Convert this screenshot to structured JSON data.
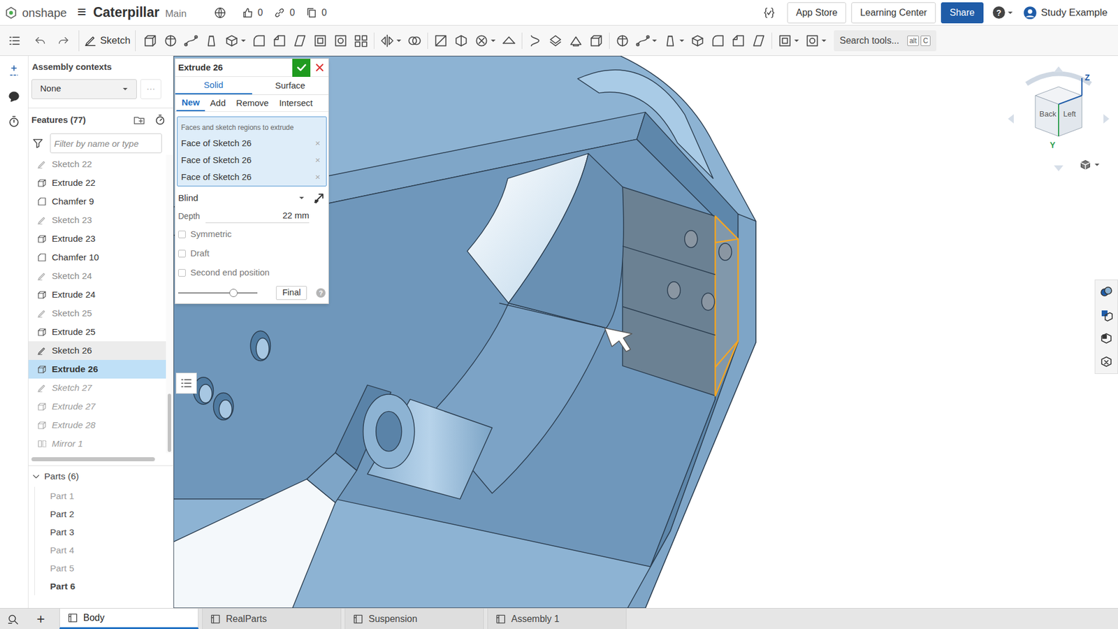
{
  "topbar": {
    "logo": "onshape",
    "menu": "≡",
    "document": "Caterpillar",
    "workspace": "Main",
    "counts": [
      "0",
      "0",
      "0"
    ],
    "buttons": [
      {
        "label": "App Store",
        "primary": false
      },
      {
        "label": "Learning Center",
        "primary": false
      },
      {
        "label": "Share",
        "primary": true
      }
    ],
    "help": "?",
    "user": "Study Example"
  },
  "toolbar": {
    "sketch": "Sketch",
    "search_placeholder": "Search tools...",
    "shortcut_keys": [
      "alt",
      "C"
    ]
  },
  "panel": {
    "assembly_label": "Assembly contexts",
    "assembly_value": "None",
    "assembly_more": "···"
  },
  "features": {
    "title": "Features (77)",
    "filter_placeholder": "Filter by name or type",
    "items": [
      {
        "name": "Sketch 22",
        "kind": "sketch",
        "state": "dimmed",
        "selected": false,
        "hovered": false
      },
      {
        "name": "Extrude 22",
        "kind": "extrude",
        "state": "normal",
        "selected": false,
        "hovered": false
      },
      {
        "name": "Chamfer 9",
        "kind": "chamfer",
        "state": "normal",
        "selected": false,
        "hovered": false
      },
      {
        "name": "Sketch 23",
        "kind": "sketch",
        "state": "dimmed",
        "selected": false,
        "hovered": false
      },
      {
        "name": "Extrude 23",
        "kind": "extrude",
        "state": "normal",
        "selected": false,
        "hovered": false
      },
      {
        "name": "Chamfer 10",
        "kind": "chamfer",
        "state": "normal",
        "selected": false,
        "hovered": false
      },
      {
        "name": "Sketch 24",
        "kind": "sketch",
        "state": "dimmed",
        "selected": false,
        "hovered": false
      },
      {
        "name": "Extrude 24",
        "kind": "extrude",
        "state": "normal",
        "selected": false,
        "hovered": false
      },
      {
        "name": "Sketch 25",
        "kind": "sketch",
        "state": "dimmed",
        "selected": false,
        "hovered": false
      },
      {
        "name": "Extrude 25",
        "kind": "extrude",
        "state": "normal",
        "selected": false,
        "hovered": false
      },
      {
        "name": "Sketch 26",
        "kind": "sketch",
        "state": "normal",
        "selected": false,
        "hovered": true
      },
      {
        "name": "Extrude 26",
        "kind": "extrude",
        "state": "normal",
        "selected": true,
        "hovered": false
      },
      {
        "name": "Sketch 27",
        "kind": "sketch",
        "state": "rolled_back",
        "selected": false,
        "hovered": false
      },
      {
        "name": "Extrude 27",
        "kind": "extrude",
        "state": "rolled_back",
        "selected": false,
        "hovered": false
      },
      {
        "name": "Extrude 28",
        "kind": "extrude",
        "state": "rolled_back",
        "selected": false,
        "hovered": false
      },
      {
        "name": "Mirror 1",
        "kind": "mirror",
        "state": "rolled_back",
        "selected": false,
        "hovered": false
      }
    ]
  },
  "parts": {
    "title": "Parts (6)",
    "expanded": true,
    "items": [
      {
        "name": "Part 1",
        "hidden": true,
        "selected": false
      },
      {
        "name": "Part 2",
        "hidden": false,
        "selected": false
      },
      {
        "name": "Part 3",
        "hidden": false,
        "selected": false
      },
      {
        "name": "Part 4",
        "hidden": true,
        "selected": false
      },
      {
        "name": "Part 5",
        "hidden": true,
        "selected": false
      },
      {
        "name": "Part 6",
        "hidden": false,
        "selected": true
      }
    ]
  },
  "dialog": {
    "title": "Extrude 26",
    "types": [
      {
        "label": "Solid",
        "selected": true
      },
      {
        "label": "Surface",
        "selected": false
      }
    ],
    "operations": [
      {
        "label": "New",
        "selected": true
      },
      {
        "label": "Add",
        "selected": false
      },
      {
        "label": "Remove",
        "selected": false
      },
      {
        "label": "Intersect",
        "selected": false
      }
    ],
    "selection": {
      "label": "Faces and sketch regions to extrude",
      "items": [
        "Face of Sketch 26",
        "Face of Sketch 26",
        "Face of Sketch 26"
      ],
      "remove": "×"
    },
    "end_type": "Blind",
    "depth": {
      "label": "Depth",
      "value": "22 mm"
    },
    "options": [
      {
        "label": "Symmetric",
        "checked": false
      },
      {
        "label": "Draft",
        "checked": false
      },
      {
        "label": "Second end position",
        "checked": false
      }
    ],
    "slider": {
      "level": 0.7
    },
    "final": "Final",
    "help": "?"
  },
  "view_cube": {
    "faces": [
      "Back",
      "Left"
    ],
    "axes": [
      "Z",
      "Y"
    ]
  },
  "bottom": {
    "add": "+",
    "tabs": [
      {
        "label": "Body",
        "selected": true
      },
      {
        "label": "RealParts",
        "selected": false
      },
      {
        "label": "Suspension",
        "selected": false
      },
      {
        "label": "Assembly 1",
        "selected": false
      }
    ]
  }
}
